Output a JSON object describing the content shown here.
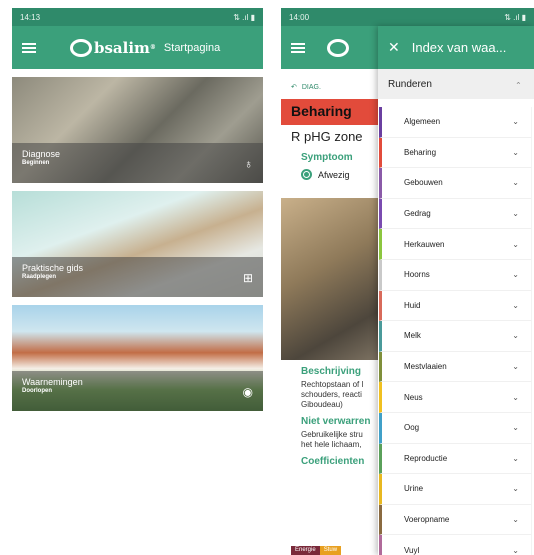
{
  "left_phone": {
    "status_time": "14:13",
    "status_icons": "⇅ .ıl ▮",
    "logo_text": "bsalim",
    "logo_mark": "®",
    "page_title": "Startpagina",
    "tiles": [
      {
        "title": "Diagnose",
        "subtitle": "Beginnen",
        "icon": "stethoscope-icon",
        "glyph": "♁"
      },
      {
        "title": "Praktische gids",
        "subtitle": "Raadplegen",
        "icon": "map-icon",
        "glyph": "⊞"
      },
      {
        "title": "Waarnemingen",
        "subtitle": "Doorlopen",
        "icon": "eye-icon",
        "glyph": "◉"
      }
    ]
  },
  "right_phone": {
    "status_time": "14:00",
    "status_icons": "⇅ .ıl ▮",
    "back_link": "DIAG.",
    "section_title": "Beharing",
    "subtitle": "R pHG zone",
    "symptoom_label": "Symptoom",
    "radio_option": "Afwezig",
    "beschrijving_label": "Beschrijving",
    "beschrijving_text": [
      "Rechtopstaan of l",
      "schouders, reacti",
      "Giboudeau)"
    ],
    "niet_verwarren_label": "Niet verwarren",
    "niet_verwarren_text": [
      "Gebruikelijke stru",
      "het hele lichaam,"
    ],
    "coefficienten_label": "Coefficienten",
    "coef_energie": "Energie",
    "coef_stuw": "Stuw",
    "index_title": "Index van waa...",
    "index_group": "Runderen",
    "index_items": [
      {
        "label": "Algemeen",
        "color": "#6a3fa0"
      },
      {
        "label": "Beharing",
        "color": "#e24b3b"
      },
      {
        "label": "Gebouwen",
        "color": "#8a5aa8"
      },
      {
        "label": "Gedrag",
        "color": "#7a4bb0"
      },
      {
        "label": "Herkauwen",
        "color": "#8cc63f"
      },
      {
        "label": "Hoorns",
        "color": "#c9c9c9"
      },
      {
        "label": "Huid",
        "color": "#d86a5a"
      },
      {
        "label": "Melk",
        "color": "#4a9a9a"
      },
      {
        "label": "Mestvlaaien",
        "color": "#7f8f3a"
      },
      {
        "label": "Neus",
        "color": "#f0c020"
      },
      {
        "label": "Oog",
        "color": "#40a0c8"
      },
      {
        "label": "Reproductie",
        "color": "#5aa05a"
      },
      {
        "label": "Urine",
        "color": "#e8b820"
      },
      {
        "label": "Voeropname",
        "color": "#8a6a40"
      },
      {
        "label": "Vuyl",
        "color": "#b06a9a"
      }
    ]
  }
}
